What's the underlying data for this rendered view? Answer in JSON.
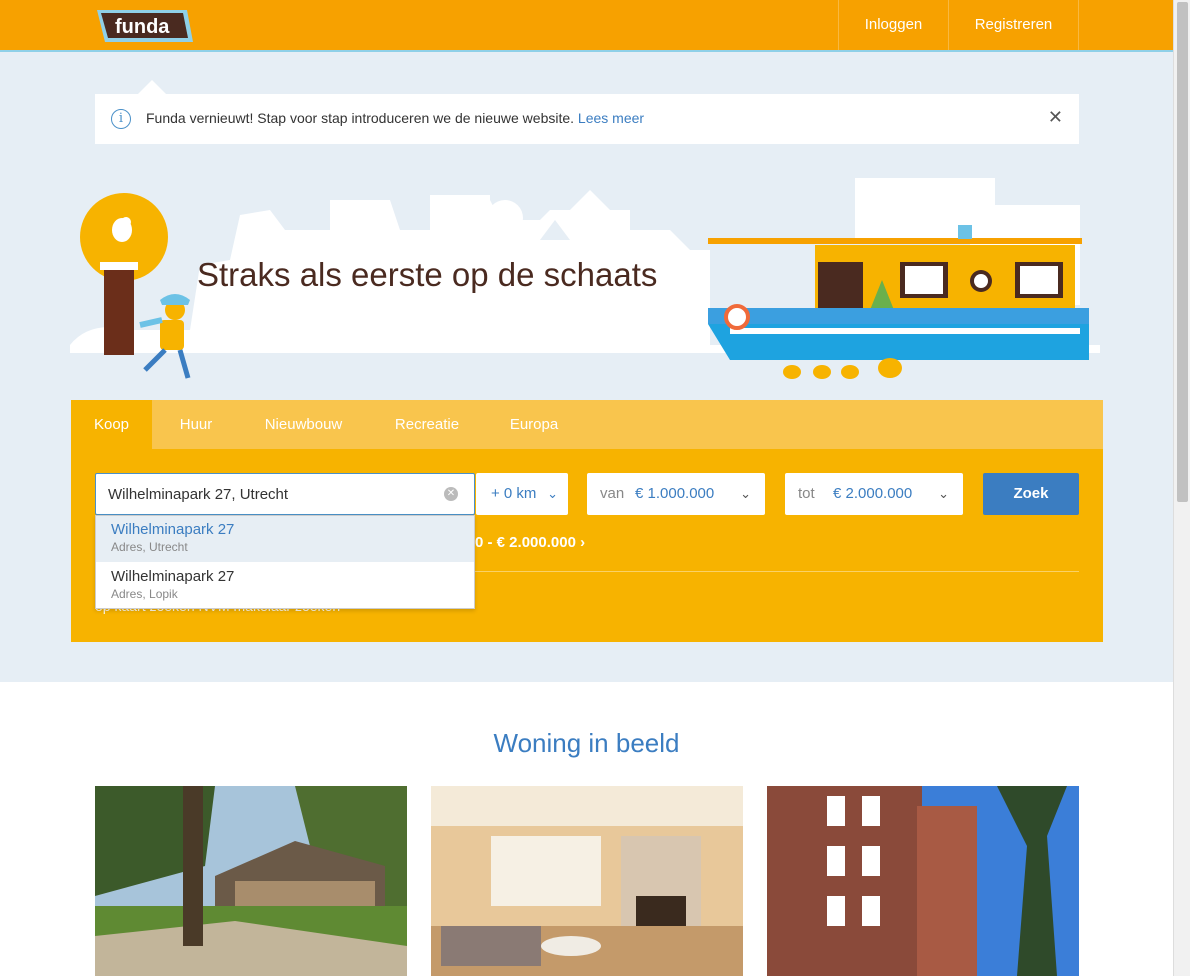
{
  "header": {
    "logo_text": "funda",
    "login_label": "Inloggen",
    "register_label": "Registreren"
  },
  "notice": {
    "text": "Funda vernieuwt! Stap voor stap introduceren we de nieuwe website.",
    "link": "Lees meer",
    "icon": "info-icon",
    "close_icon": "close-icon"
  },
  "hero": {
    "title": "Straks als eerste op de schaats"
  },
  "search": {
    "tabs": [
      "Koop",
      "Huur",
      "Nieuwbouw",
      "Recreatie",
      "Europa"
    ],
    "active_tab": "Koop",
    "location_value": "Wilhelminapark 27, Utrecht",
    "radius": "+ 0 km",
    "van_label": "van",
    "van_value": "€ 1.000.000",
    "tot_label": "tot",
    "tot_value": "€ 2.000.000",
    "submit_label": "Zoek",
    "recent_text": "0 - € 2.000.000",
    "sublinks_text": "op kaart zoeken    NVM makelaar zoeken"
  },
  "suggestions": [
    {
      "main": "Wilhelminapark 27",
      "sub": "Adres, Utrecht"
    },
    {
      "main": "Wilhelminapark 27",
      "sub": "Adres, Lopik"
    }
  ],
  "section": {
    "title": "Woning in beeld"
  },
  "colors": {
    "brand_orange": "#f7a100",
    "panel": "#f7b300",
    "blue": "#3b7dc1"
  }
}
